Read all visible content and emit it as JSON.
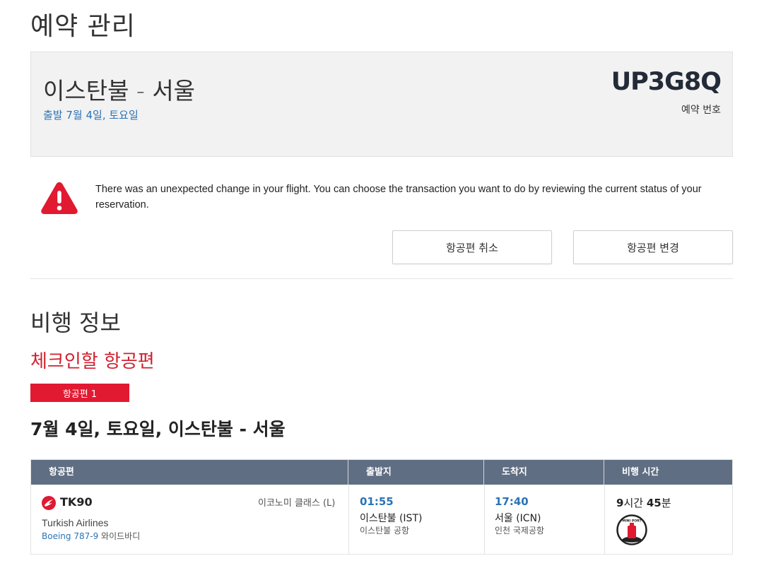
{
  "page_title": "예약 관리",
  "summary": {
    "route": "이스탄불 - 서울",
    "departure": "출발 7월 4일, 토요일",
    "pnr": "UP3G8Q",
    "pnr_label": "예약 번호"
  },
  "alert": {
    "icon": "warning-triangle-icon",
    "color": "#e11931",
    "message": "There was an unexpected change in your flight. You can choose the transaction you want to do by reviewing the current status of your reservation."
  },
  "actions": {
    "cancel_label": "항공편 취소",
    "change_label": "항공편 변경"
  },
  "flight_info": {
    "section_title": "비행 정보",
    "checkin_title": "체크인할 항공편",
    "badge": "항공편 1",
    "date_route": "7월 4일, 토요일, 이스탄불 - 서울"
  },
  "table": {
    "headers": [
      "항공편",
      "출발지",
      "도착지",
      "비행 시간"
    ],
    "row": {
      "flight_number": "TK90",
      "cabin": "이코노미 클래스 (L)",
      "airline": "Turkish Airlines",
      "aircraft_model": "Boeing 787-9",
      "aircraft_type": "와이드바디",
      "departure_time": "01:55",
      "departure_city": "이스탄불 (IST)",
      "departure_airport": "이스탄불 공항",
      "arrival_time": "17:40",
      "arrival_city": "서울 (ICN)",
      "arrival_airport": "인천 국제공항",
      "duration_hours": "9",
      "duration_hours_unit": "시간",
      "duration_minutes": "45",
      "duration_minutes_unit": "분",
      "badge_icon": "miniport-icon",
      "badge_text": "MINI PORT"
    }
  },
  "colors": {
    "brand_red": "#e11931",
    "link_blue": "#2b73b6",
    "table_header": "#5f6e82"
  }
}
